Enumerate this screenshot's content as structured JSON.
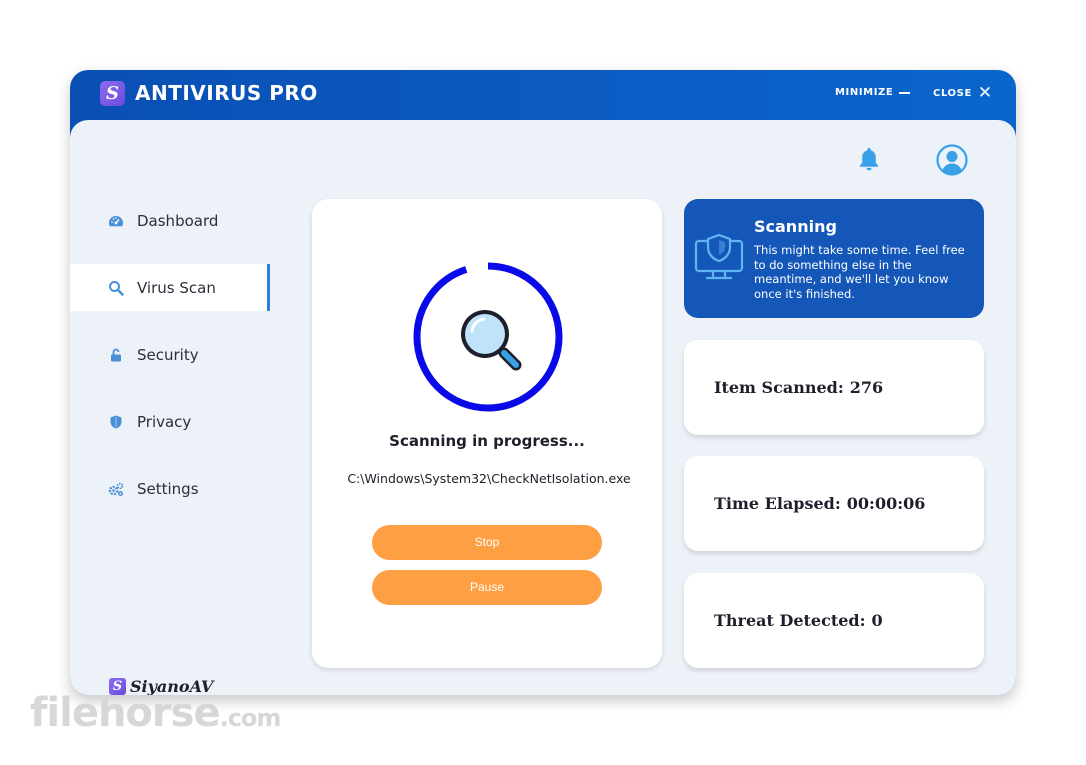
{
  "titlebar": {
    "app_title": "ANTIVIRUS PRO",
    "logo_letter": "S",
    "minimize_label": "MINIMIZE",
    "close_label": "CLOSE"
  },
  "sidebar": {
    "items": [
      {
        "label": "Dashboard",
        "icon": "dashboard-gauge-icon"
      },
      {
        "label": "Virus Scan",
        "icon": "search-icon",
        "active": true
      },
      {
        "label": "Security",
        "icon": "lock-icon"
      },
      {
        "label": "Privacy",
        "icon": "shield-icon"
      },
      {
        "label": "Settings",
        "icon": "gears-icon"
      }
    ],
    "brand": {
      "logo_letter": "S",
      "name": "SiyanoAV"
    }
  },
  "scan": {
    "status": "Scanning in progress...",
    "current_path": "C:\\Windows\\System32\\CheckNetIsolation.exe",
    "progress_fraction": 0.95,
    "stop_label": "Stop",
    "pause_label": "Pause"
  },
  "info": {
    "title": "Scanning",
    "text": "This might take some time. Feel free to do something else in the meantime, and we'll let you know once it's finished."
  },
  "stats": [
    {
      "label": "Item Scanned:",
      "value": "276"
    },
    {
      "label": "Time Elapsed:",
      "value": "00:00:06"
    },
    {
      "label": "Threat Detected:",
      "value": "0"
    }
  ],
  "watermark": {
    "main": "filehorse",
    "suffix": ".com"
  },
  "colors": {
    "titlebar": "#0b5cc4",
    "content_bg": "#edf1f8",
    "accent_blue": "#2f7ed8",
    "progress_ring": "#0a0ae8",
    "button_orange": "#ff9f43",
    "info_card": "#1557b8"
  }
}
